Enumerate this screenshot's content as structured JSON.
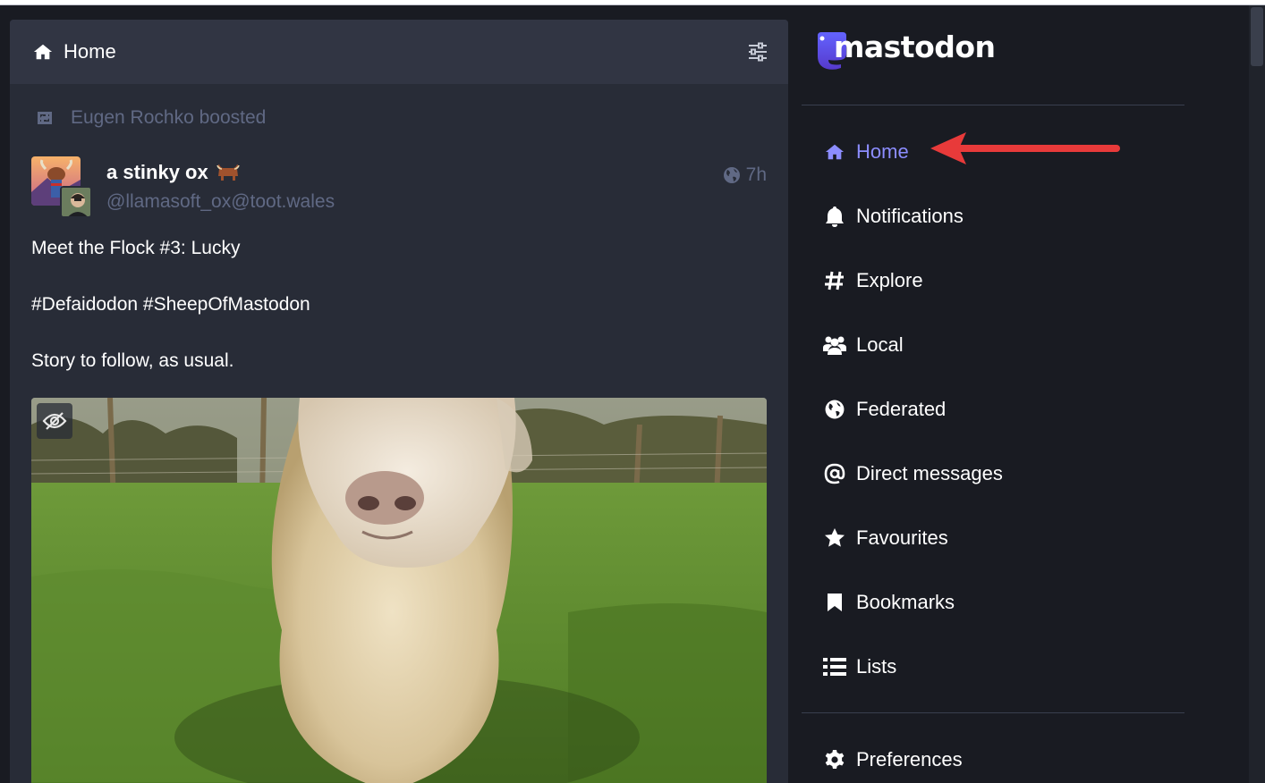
{
  "column": {
    "title": "Home"
  },
  "status": {
    "boosted_by": "Eugen Rochko boosted",
    "display_name": "a stinky ox",
    "handle": "@llamasoft_ox@toot.wales",
    "relative_time": "7h",
    "paragraphs": [
      "Meet the Flock #3: Lucky",
      "#Defaidodon #SheepOfMastodon",
      "Story to follow, as usual."
    ]
  },
  "sidebar": {
    "logo_text": "mastodon",
    "items": [
      {
        "label": "Home",
        "icon": "home-icon",
        "active": true
      },
      {
        "label": "Notifications",
        "icon": "bell-icon"
      },
      {
        "label": "Explore",
        "icon": "hashtag-icon"
      },
      {
        "label": "Local",
        "icon": "users-icon"
      },
      {
        "label": "Federated",
        "icon": "globe-icon"
      },
      {
        "label": "Direct messages",
        "icon": "at-icon"
      },
      {
        "label": "Favourites",
        "icon": "star-icon"
      },
      {
        "label": "Bookmarks",
        "icon": "bookmark-icon"
      },
      {
        "label": "Lists",
        "icon": "list-icon"
      },
      {
        "label": "Preferences",
        "icon": "gear-icon"
      }
    ]
  },
  "colors": {
    "background": "#191b22",
    "column": "#282c37",
    "header": "#313543",
    "muted": "#606984",
    "accent": "#8c8dff",
    "annotation_arrow": "#e83a3a"
  }
}
